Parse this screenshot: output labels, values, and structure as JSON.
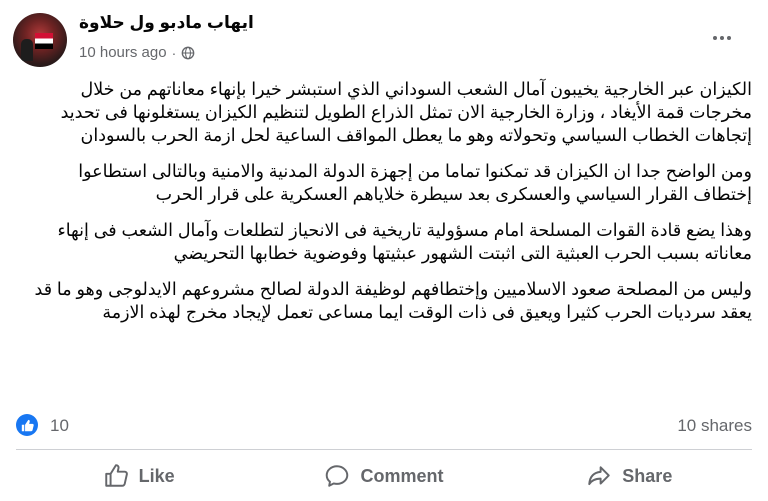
{
  "post": {
    "author": "ايهاب مادبو ول حلاوة",
    "time": "10 hours ago",
    "separator": "·",
    "paragraphs": [
      "الكيزان عبر الخارجية يخيبون آمال الشعب السوداني الذي استبشر خيرا بإنهاء معاناتهم من خلال مخرجات قمة الأيغاد ، وزارة الخارجية الان تمثل الذراع الطويل لتنظيم الكيزان يستغلونها فى تحديد إتجاهات الخطاب السياسي وتحولاته وهو ما يعطل المواقف الساعية لحل ازمة الحرب بالسودان",
      "ومن الواضح جدا ان الكيزان قد تمكنوا تماما من إجهزة الدولة المدنية والامنية وبالتالى استطاعوا إختطاف القرار السياسي والعسكرى بعد سيطرة خلاياهم العسكرية على قرار الحرب",
      "وهذا يضع قادة القوات المسلحة امام مسؤولية تاريخية فى الانحياز لتطلعات وآمال الشعب فى إنهاء معاناته بسبب الحرب العبثية التى اثبتت الشهور عبثيتها وفوضوية خطابها التحريضي",
      "وليس من المصلحة صعود الاسلاميين وإختطافهم لوظيفة الدولة لصالح مشروعهم الايدلوجى وهو ما قد يعقد سرديات الحرب كثيرا ويعيق فى ذات الوقت ايما مساعى تعمل لإيجاد مخرج لهذه الازمة"
    ]
  },
  "stats": {
    "likes": "10",
    "shares": "10 shares"
  },
  "actions": {
    "like": "Like",
    "comment": "Comment",
    "share": "Share"
  },
  "colors": {
    "accent": "#1877f2",
    "muted": "#65676b",
    "text": "#050505"
  },
  "icons": [
    "globe-icon",
    "more-options-icon",
    "like-reaction-icon",
    "thumbs-up-icon",
    "comment-icon",
    "share-icon"
  ]
}
